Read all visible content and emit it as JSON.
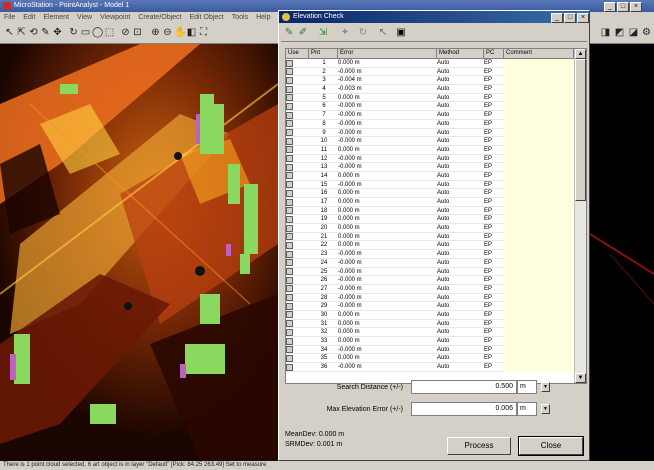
{
  "app": {
    "title": "MicroStation - PointAnalyst - Model 1",
    "menu": [
      "File",
      "Edit",
      "Element",
      "View",
      "Viewpoint",
      "Create/Object",
      "Edit Object",
      "Tools",
      "Help"
    ],
    "status_text": "There is 1 point cloud selected, 6 art object is in layer \"Default\"  [Pick: 84.25 263.49]  Set to measure"
  },
  "dialog": {
    "title": "Elevation Check",
    "columns": [
      "Use",
      "Pnt",
      "Error",
      "Method",
      "PC",
      "Comment"
    ],
    "rows": [
      {
        "pnt": "1",
        "error": "0.000 m",
        "method": "Auto",
        "pc": "EP"
      },
      {
        "pnt": "2",
        "error": "-0.000 m",
        "method": "Auto",
        "pc": "EP"
      },
      {
        "pnt": "3",
        "error": "-0.004 m",
        "method": "Auto",
        "pc": "EP"
      },
      {
        "pnt": "4",
        "error": "-0.003 m",
        "method": "Auto",
        "pc": "EP"
      },
      {
        "pnt": "5",
        "error": "0.000 m",
        "method": "Auto",
        "pc": "EP"
      },
      {
        "pnt": "6",
        "error": "-0.000 m",
        "method": "Auto",
        "pc": "EP"
      },
      {
        "pnt": "7",
        "error": "-0.000 m",
        "method": "Auto",
        "pc": "EP"
      },
      {
        "pnt": "8",
        "error": "-0.000 m",
        "method": "Auto",
        "pc": "EP"
      },
      {
        "pnt": "9",
        "error": "-0.000 m",
        "method": "Auto",
        "pc": "EP"
      },
      {
        "pnt": "10",
        "error": "-0.000 m",
        "method": "Auto",
        "pc": "EP"
      },
      {
        "pnt": "11",
        "error": "0.000 m",
        "method": "Auto",
        "pc": "EP"
      },
      {
        "pnt": "12",
        "error": "-0.000 m",
        "method": "Auto",
        "pc": "EP"
      },
      {
        "pnt": "13",
        "error": "-0.000 m",
        "method": "Auto",
        "pc": "EP"
      },
      {
        "pnt": "14",
        "error": "0.000 m",
        "method": "Auto",
        "pc": "EP"
      },
      {
        "pnt": "15",
        "error": "-0.000 m",
        "method": "Auto",
        "pc": "EP"
      },
      {
        "pnt": "16",
        "error": "0.000 m",
        "method": "Auto",
        "pc": "EP"
      },
      {
        "pnt": "17",
        "error": "0.000 m",
        "method": "Auto",
        "pc": "EP"
      },
      {
        "pnt": "18",
        "error": "0.000 m",
        "method": "Auto",
        "pc": "EP"
      },
      {
        "pnt": "19",
        "error": "0.000 m",
        "method": "Auto",
        "pc": "EP"
      },
      {
        "pnt": "20",
        "error": "0.000 m",
        "method": "Auto",
        "pc": "EP"
      },
      {
        "pnt": "21",
        "error": "0.000 m",
        "method": "Auto",
        "pc": "EP"
      },
      {
        "pnt": "22",
        "error": "0.000 m",
        "method": "Auto",
        "pc": "EP"
      },
      {
        "pnt": "23",
        "error": "-0.000 m",
        "method": "Auto",
        "pc": "EP"
      },
      {
        "pnt": "24",
        "error": "-0.000 m",
        "method": "Auto",
        "pc": "EP"
      },
      {
        "pnt": "25",
        "error": "-0.000 m",
        "method": "Auto",
        "pc": "EP"
      },
      {
        "pnt": "26",
        "error": "-0.000 m",
        "method": "Auto",
        "pc": "EP"
      },
      {
        "pnt": "27",
        "error": "-0.000 m",
        "method": "Auto",
        "pc": "EP"
      },
      {
        "pnt": "28",
        "error": "-0.000 m",
        "method": "Auto",
        "pc": "EP"
      },
      {
        "pnt": "29",
        "error": "-0.000 m",
        "method": "Auto",
        "pc": "EP"
      },
      {
        "pnt": "30",
        "error": "0.000 m",
        "method": "Auto",
        "pc": "EP"
      },
      {
        "pnt": "31",
        "error": "0.000 m",
        "method": "Auto",
        "pc": "EP"
      },
      {
        "pnt": "32",
        "error": "0.000 m",
        "method": "Auto",
        "pc": "EP"
      },
      {
        "pnt": "33",
        "error": "0.000 m",
        "method": "Auto",
        "pc": "EP"
      },
      {
        "pnt": "34",
        "error": "-0.000 m",
        "method": "Auto",
        "pc": "EP"
      },
      {
        "pnt": "35",
        "error": "0.000 m",
        "method": "Auto",
        "pc": "EP"
      },
      {
        "pnt": "36",
        "error": "-0.000 m",
        "method": "Auto",
        "pc": "EP"
      }
    ],
    "search_distance_label": "Search Distance (+/-)",
    "search_distance_value": "0.500",
    "search_distance_unit": "m",
    "max_error_label": "Max Elevation Error (+/-)",
    "max_error_value": "0.006",
    "max_error_unit": "m",
    "mean_dev": "MeanDev: 0.000 m",
    "srm_dev": "SRMDev: 0.001 m",
    "process_label": "Process",
    "close_label": "Close"
  },
  "colors": {
    "dialog_title": "#0a246a",
    "comment_cell": "#ffffe0",
    "dialog_face": "#d4d0c8"
  }
}
